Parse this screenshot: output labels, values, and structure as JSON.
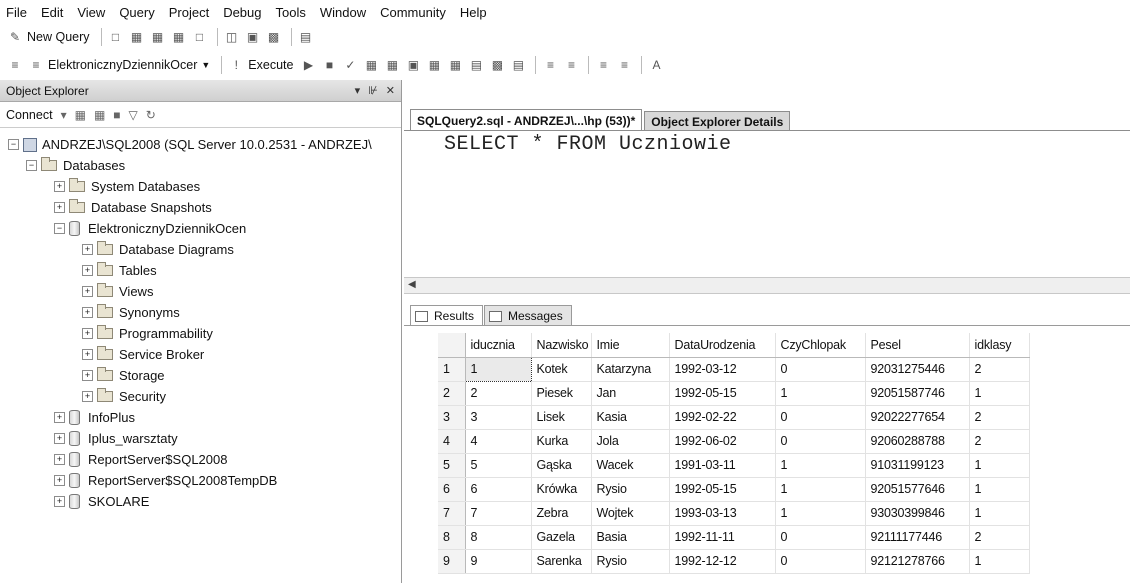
{
  "menu": [
    "File",
    "Edit",
    "View",
    "Query",
    "Project",
    "Debug",
    "Tools",
    "Window",
    "Community",
    "Help"
  ],
  "toolbar": {
    "new_query": "New Query",
    "database": "ElektronicznyDziennikOcer",
    "execute": "Execute"
  },
  "object_explorer": {
    "title": "Object Explorer",
    "connect": "Connect",
    "server": "ANDRZEJ\\SQL2008 (SQL Server 10.0.2531 - ANDRZEJ\\",
    "databases": "Databases",
    "nodes": [
      {
        "label": "System Databases"
      },
      {
        "label": "Database Snapshots"
      },
      {
        "label": "ElektronicznyDziennikOcen"
      },
      {
        "label": "Database Diagrams"
      },
      {
        "label": "Tables"
      },
      {
        "label": "Views"
      },
      {
        "label": "Synonyms"
      },
      {
        "label": "Programmability"
      },
      {
        "label": "Service Broker"
      },
      {
        "label": "Storage"
      },
      {
        "label": "Security"
      },
      {
        "label": "InfoPlus"
      },
      {
        "label": "Iplus_warsztaty"
      },
      {
        "label": "ReportServer$SQL2008"
      },
      {
        "label": "ReportServer$SQL2008TempDB"
      },
      {
        "label": "SKOLARE"
      }
    ]
  },
  "tabs": {
    "query": "SQLQuery2.sql - ANDRZEJ\\...\\hp (53))*",
    "details": "Object Explorer Details"
  },
  "editor": {
    "sql": "SELECT * FROM Uczniowie"
  },
  "results": {
    "tab_results": "Results",
    "tab_messages": "Messages",
    "columns": [
      "iducznia",
      "Nazwisko",
      "Imie",
      "DataUrodzenia",
      "CzyChlopak",
      "Pesel",
      "idklasy"
    ],
    "rows": [
      {
        "n": "1",
        "cells": [
          "1",
          "Kotek",
          "Katarzyna",
          "1992-03-12",
          "0",
          "92031275446",
          "2"
        ]
      },
      {
        "n": "2",
        "cells": [
          "2",
          "Piesek",
          "Jan",
          "1992-05-15",
          "1",
          "92051587746",
          "1"
        ]
      },
      {
        "n": "3",
        "cells": [
          "3",
          "Lisek",
          "Kasia",
          "1992-02-22",
          "0",
          "92022277654",
          "2"
        ]
      },
      {
        "n": "4",
        "cells": [
          "4",
          "Kurka",
          "Jola",
          "1992-06-02",
          "0",
          "92060288788",
          "2"
        ]
      },
      {
        "n": "5",
        "cells": [
          "5",
          "Gąska",
          "Wacek",
          "1991-03-11",
          "1",
          "91031199123",
          "1"
        ]
      },
      {
        "n": "6",
        "cells": [
          "6",
          "Krówka",
          "Rysio",
          "1992-05-15",
          "1",
          "92051577646",
          "1"
        ]
      },
      {
        "n": "7",
        "cells": [
          "7",
          "Zebra",
          "Wojtek",
          "1993-03-13",
          "1",
          "93030399846",
          "1"
        ]
      },
      {
        "n": "8",
        "cells": [
          "8",
          "Gazela",
          "Basia",
          "1992-11-11",
          "0",
          "92111177446",
          "2"
        ]
      },
      {
        "n": "9",
        "cells": [
          "9",
          "Sarenka",
          "Rysio",
          "1992-12-12",
          "0",
          "92121278766",
          "1"
        ]
      }
    ]
  },
  "icons": [
    "new-query-icon",
    "save-icon",
    "execute-icon",
    "parse-icon",
    "results-grid-icon",
    "messages-icon",
    "folder-icon",
    "database-icon",
    "server-icon"
  ]
}
